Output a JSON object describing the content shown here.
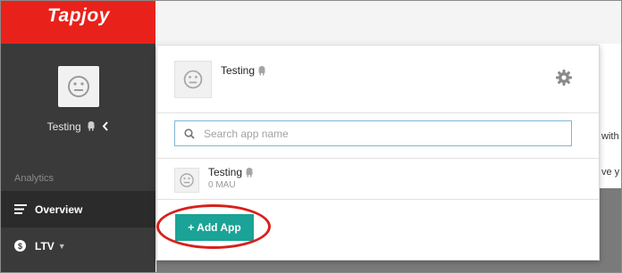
{
  "brand": {
    "logo_text": "Tapjoy",
    "color": "#e8221b"
  },
  "sidebar": {
    "app_name": "Testing",
    "section_label": "Analytics",
    "items": [
      {
        "label": "Overview",
        "icon": "lines-icon",
        "active": true
      },
      {
        "label": "LTV",
        "icon": "dollar-icon",
        "has_dropdown": true
      }
    ]
  },
  "popover": {
    "app_title": "Testing",
    "search": {
      "placeholder": "Search app name",
      "value": ""
    },
    "apps": [
      {
        "name": "Testing",
        "mau": "0 MAU",
        "platform_icon": "android-icon"
      }
    ],
    "add_button_label": "+ Add App"
  },
  "background": {
    "partial_text_1": "with",
    "partial_text_2": "ve y"
  },
  "colors": {
    "accent": "#1aa396",
    "sidebar_bg": "#3a3a3a",
    "highlight": "#d8201c"
  }
}
